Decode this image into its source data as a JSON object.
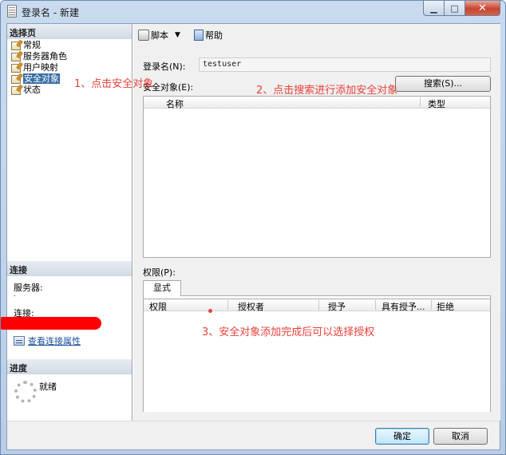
{
  "window": {
    "title": "登录名 - 新建",
    "min_symbol": "▁",
    "max_symbol": "□",
    "close_symbol": "✕"
  },
  "left": {
    "pages_header": "选择页",
    "pages": [
      "常规",
      "服务器角色",
      "用户映射",
      "安全对象",
      "状态"
    ],
    "selected_page": "安全对象",
    "connection_header": "连接",
    "server_label": "服务器:",
    "server_value": ".",
    "connection_label": "连接:",
    "view_connection_properties": "查看连接属性",
    "progress_header": "进度",
    "progress_status": "就绪"
  },
  "toolbar": {
    "script": "脚本",
    "script_dropdown": "▼",
    "help": "帮助"
  },
  "main": {
    "login_name_label": "登录名(N):",
    "login_name_value": "testuser",
    "securables_label": "安全对象(E):",
    "search_button": "搜索(S)...",
    "securables_columns": [
      "名称",
      "类型"
    ],
    "permissions_label": "权限(P):",
    "tab_explicit": "显式",
    "permissions_columns": [
      "权限",
      "授权者",
      "授予",
      "具有授予...",
      "拒绝"
    ]
  },
  "annotations": {
    "step1": "1、点击安全对象",
    "step2": "2、点击搜索进行添加安全对象",
    "step3": "3、安全对象添加完成后可以选择授权",
    "color": "#e8413a"
  },
  "footer": {
    "ok": "确定",
    "cancel": "取消"
  },
  "colors": {
    "selection": "#3a6ea5",
    "redaction": "#ff0000",
    "link": "#1a4fa0"
  }
}
